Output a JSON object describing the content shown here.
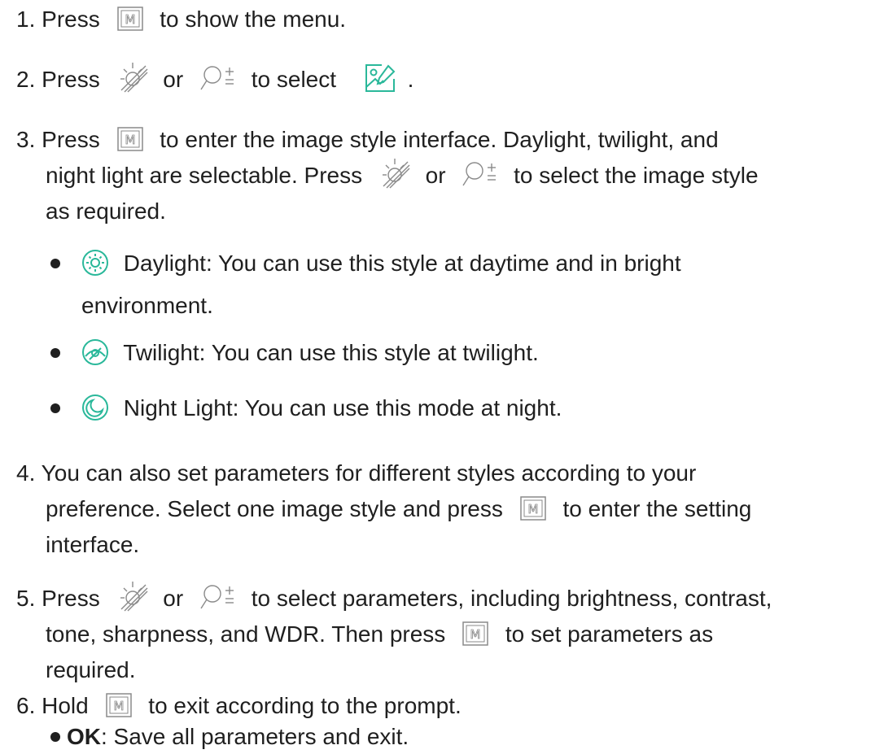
{
  "steps": {
    "s1": {
      "num": "1.",
      "a": "Press",
      "b": "to show the menu."
    },
    "s2": {
      "num": "2.",
      "a": "Press",
      "or": "or",
      "b": "to select",
      "c": "."
    },
    "s3": {
      "num": "3.",
      "a": "Press",
      "b": "to enter the image style interface. Daylight, twilight, and",
      "line2a": "night light are selectable. Press",
      "or": "or",
      "line2b": "to select the image style",
      "line3": "as required."
    },
    "s4": {
      "num": "4.",
      "line1": "You can also set parameters for different styles according to your",
      "line2a": "preference. Select one image style and press",
      "line2b": "to enter the setting",
      "line3": "interface."
    },
    "s5": {
      "num": "5.",
      "a": "Press",
      "or": "or",
      "b": "to select parameters, including brightness, contrast,",
      "line2a": "tone, sharpness, and WDR. Then press",
      "line2b": "to set parameters as",
      "line3": "required."
    },
    "s6": {
      "num": "6.",
      "a": "Hold",
      "b": "to exit according to the prompt."
    }
  },
  "styles": [
    {
      "icon": "daylight-icon",
      "line1": "Daylight: You can use this style at daytime and in bright",
      "line2": "environment."
    },
    {
      "icon": "twilight-icon",
      "line1": "Twilight: You can use this style at twilight."
    },
    {
      "icon": "night-light-icon",
      "line1": "Night Light: You can use this mode at night."
    }
  ],
  "ok": {
    "label": "OK",
    "text": ": Save all parameters and exit."
  },
  "icons": {
    "menu_key": "m-key-icon",
    "brightness": "brightness-icon",
    "zoom": "zoom-icon",
    "image_style": "image-style-icon"
  },
  "colors": {
    "text": "#1f1f1f",
    "accent": "#2ab89a",
    "icon_gray": "#8a8a8a"
  }
}
